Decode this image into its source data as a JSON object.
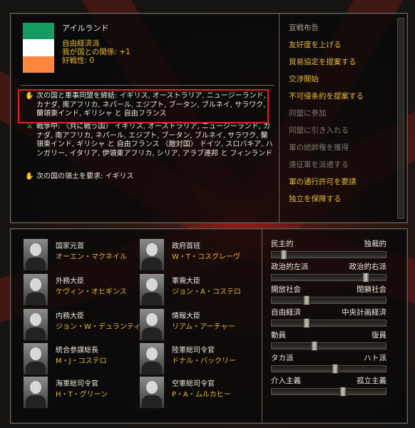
{
  "country": {
    "name": "アイルランド",
    "ideology": "自由経済派",
    "relation": "我が国との関係: +1",
    "belligerence": "好戦性: 0",
    "flag_colors": [
      "#169b62",
      "#ffffff",
      "#ff883e"
    ]
  },
  "events": [
    {
      "icon": "handshake-icon",
      "glyph": "✋",
      "text": "次の国と軍事同盟を締結: イギリス, オーストラリア, ニュージーランド, カナダ, 南アフリカ, ネパール, エジプト, ブータン, ブルネイ, サラワク, 蘭領東インド, ギリシャ と 自由フランス"
    },
    {
      "icon": "crossed-swords-icon",
      "glyph": "⚔",
      "text": "戦争中: 〈共に戦う国〉 イギリス, オーストラリア, ニュージーランド, カナダ, 南アフリカ, ネパール, エジプト, ブータン, ブルネイ, サラワク, 蘭領東インド, ギリシャ と 自由フランス 〈敵対国〉 ドイツ, スロバキア, ハンガリー, イタリア, 伊領東アフリカ, シリア, アラブ連邦 と フィンランド"
    },
    {
      "icon": "hand-icon",
      "glyph": "✋",
      "text": "次の国の領土を要求: イギリス"
    }
  ],
  "actions": [
    {
      "label": "宣戦布告",
      "state": "head"
    },
    {
      "label": "友好度を上げる",
      "state": "on"
    },
    {
      "label": "貿易協定を提案する",
      "state": "on"
    },
    {
      "label": "交渉開始",
      "state": "on"
    },
    {
      "label": "不可侵条約を提案する",
      "state": "on"
    },
    {
      "label": "同盟に参加",
      "state": "off"
    },
    {
      "label": "同盟に引き入れる",
      "state": "off"
    },
    {
      "label": "軍の統帥権を獲得",
      "state": "off"
    },
    {
      "label": "遠征軍を派遣する",
      "state": "off"
    },
    {
      "label": "軍の通行許可を要請",
      "state": "on"
    },
    {
      "label": "独立を保障する",
      "state": "on"
    }
  ],
  "cabinet": [
    {
      "role": "国家元首",
      "name": "オーエン・マクネイル"
    },
    {
      "role": "政府首班",
      "name": "W・T・コスグレーヴ"
    },
    {
      "role": "外務大臣",
      "name": "ケヴィン・オヒギンス"
    },
    {
      "role": "軍需大臣",
      "name": "ジョン・A・コステロ"
    },
    {
      "role": "内務大臣",
      "name": "ジョン・W・デュランティ"
    },
    {
      "role": "情報大臣",
      "name": "リアム・アーチャー"
    },
    {
      "role": "統合参謀総長",
      "name": "M・J・コステロ"
    },
    {
      "role": "陸軍総司令官",
      "name": "ドナル・バックリー"
    },
    {
      "role": "海軍総司令官",
      "name": "H・T・グリーン"
    },
    {
      "role": "空軍総司令官",
      "name": "P・A・ムルカヒー"
    }
  ],
  "sliders": [
    {
      "left": "民主的",
      "right": "独裁的",
      "value": 0.1
    },
    {
      "left": "政治的左派",
      "right": "政治的右派",
      "value": 0.82
    },
    {
      "left": "開放社会",
      "right": "閉鎖社会",
      "value": 0.3
    },
    {
      "left": "自由経済",
      "right": "中央計画経済",
      "value": 0.3
    },
    {
      "left": "動員",
      "right": "復員",
      "value": 0.37
    },
    {
      "left": "タカ派",
      "right": "ハト派",
      "value": 0.55
    },
    {
      "left": "介入主義",
      "right": "孤立主義",
      "value": 0.62
    }
  ]
}
